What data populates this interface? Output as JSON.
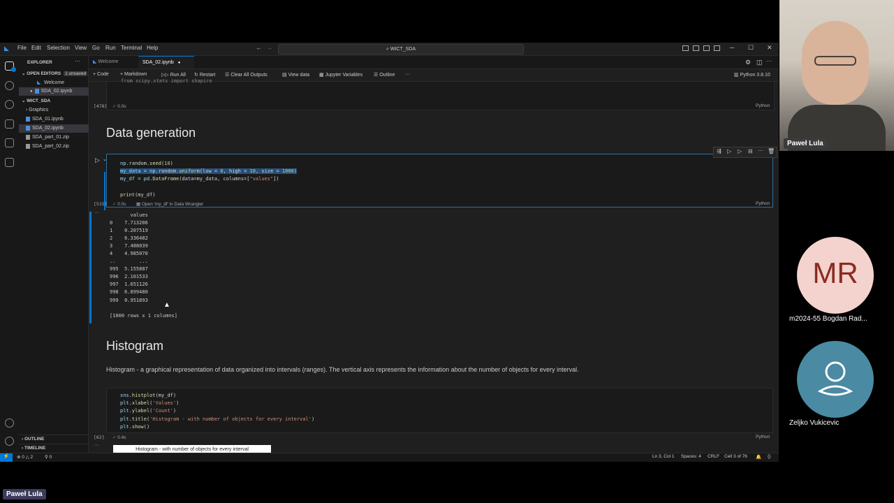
{
  "menu": [
    "File",
    "Edit",
    "Selection",
    "View",
    "Go",
    "Run",
    "Terminal",
    "Help"
  ],
  "command_center": "WICT_SDA",
  "sidebar": {
    "title": "EXPLORER",
    "open_editors_label": "OPEN EDITORS",
    "unsaved_badge": "1 unsaved",
    "open_editors": [
      "Welcome",
      "SDA_02.ipynb"
    ],
    "folder": "WICT_SDA",
    "items": [
      "Graphics",
      "SDA_01.ipynb",
      "SDA_02.ipynb",
      "SDA_part_01.zip",
      "SDA_part_02.zip"
    ],
    "outline": "OUTLINE",
    "timeline": "TIMELINE"
  },
  "tabs": [
    "Welcome",
    "SDA_02.ipynb"
  ],
  "toolbar": {
    "code": "Code",
    "markdown": "Markdown",
    "run_all": "Run All",
    "restart": "Restart",
    "clear": "Clear All Outputs",
    "view_data": "View data",
    "jupyter_vars": "Jupyter Variables",
    "outline": "Outline",
    "kernel": "Python 3.8.10"
  },
  "cell_prev": {
    "exec": "[478]",
    "time": "0.0s",
    "lang": "Python"
  },
  "heading1": "Data generation",
  "cell1": {
    "lines": [
      "np.random.seed(10)",
      "my_data = np.random.uniform(low = 0, high = 10, size = 1000)",
      "my_df = pd.DataFrame(data=my_data, columns=[\"values\"])",
      "",
      "print(my_df)"
    ],
    "exec": "[515]",
    "time": "0.0s",
    "wrangler": "Open 'my_df' in Data Wrangler",
    "lang": "Python"
  },
  "output1": {
    "lines": [
      "       values",
      "0    7.713206",
      "1    0.207519",
      "2    6.336482",
      "3    7.488039",
      "4    4.985070",
      "..        ...",
      "995  5.155887",
      "996  2.101533",
      "997  1.651126",
      "998  6.899480",
      "999  0.951893",
      "",
      "[1000 rows x 1 columns]"
    ]
  },
  "heading2": "Histogram",
  "paragraph": "Histogram - a graphical representation of data organized into intervals (ranges). The vertical axis represents the information about the number of objects for every interval.",
  "cell2": {
    "lines": [
      "sns.histplot(my_df)",
      "plt.xlabel('Values')",
      "plt.ylabel('Count')",
      "plt.title('Histogram - with number of objects for every interval')",
      "plt.show()"
    ],
    "exec": "[62]",
    "time": "0.4s",
    "lang": "Python"
  },
  "plot_title": "Histogram - with number of objects for every interval",
  "status": {
    "errors": "0",
    "warnings": "2",
    "ports": "0",
    "position": "Ln 3, Col 1",
    "spaces": "Spaces: 4",
    "eol": "CRLF",
    "cell": "Cell 3 of 76"
  },
  "participants": {
    "presenter": "Paweł Lula",
    "p2_initials": "MR",
    "p2_name": "m2024-55 Bogdan Rad...",
    "p3_name": "Zeljko Vukicevic",
    "bottom_tag": "Paweł Lula"
  },
  "colors": {
    "accent": "#0078d4",
    "avatar_mr": "#f4d3ce",
    "avatar_mr_text": "#8a2b22",
    "avatar_zv": "#4a8aa3"
  }
}
